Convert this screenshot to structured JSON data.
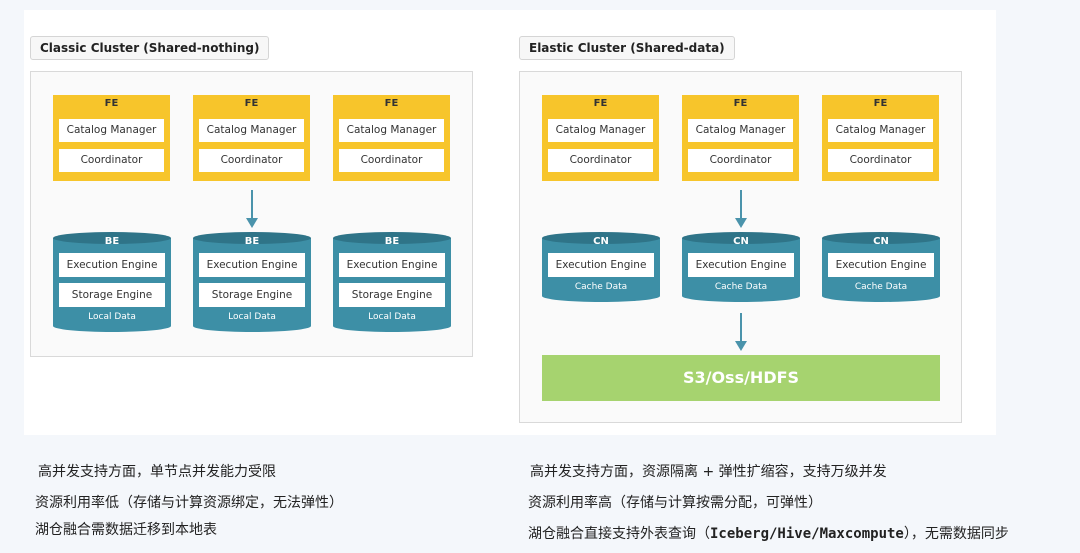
{
  "classic": {
    "title": "Classic Cluster (Shared-nothing)",
    "fe_nodes": [
      {
        "label": "FE",
        "catalog": "Catalog Manager",
        "coordinator": "Coordinator"
      },
      {
        "label": "FE",
        "catalog": "Catalog Manager",
        "coordinator": "Coordinator"
      },
      {
        "label": "FE",
        "catalog": "Catalog Manager",
        "coordinator": "Coordinator"
      }
    ],
    "be_nodes": [
      {
        "label": "BE",
        "execution": "Execution Engine",
        "storage": "Storage Engine",
        "data": "Local Data"
      },
      {
        "label": "BE",
        "execution": "Execution Engine",
        "storage": "Storage Engine",
        "data": "Local Data"
      },
      {
        "label": "BE",
        "execution": "Execution Engine",
        "storage": "Storage Engine",
        "data": "Local Data"
      }
    ]
  },
  "elastic": {
    "title": "Elastic Cluster (Shared-data)",
    "fe_nodes": [
      {
        "label": "FE",
        "catalog": "Catalog Manager",
        "coordinator": "Coordinator"
      },
      {
        "label": "FE",
        "catalog": "Catalog Manager",
        "coordinator": "Coordinator"
      },
      {
        "label": "FE",
        "catalog": "Catalog Manager",
        "coordinator": "Coordinator"
      }
    ],
    "cn_nodes": [
      {
        "label": "CN",
        "execution": "Execution Engine",
        "data": "Cache Data"
      },
      {
        "label": "CN",
        "execution": "Execution Engine",
        "data": "Cache Data"
      },
      {
        "label": "CN",
        "execution": "Execution Engine",
        "data": "Cache Data"
      }
    ],
    "storage": "S3/Oss/HDFS"
  },
  "notes_left": [
    "高并发支持方面，单节点并发能力受限",
    "资源利用率低（存储与计算资源绑定，无法弹性）",
    "湖仓融合需数据迁移到本地表"
  ],
  "notes_right": [
    "高并发支持方面，资源隔离 + 弹性扩缩容，支持万级并发",
    "资源利用率高（存储与计算按需分配，可弹性）"
  ],
  "notes_right_last": {
    "prefix": "湖仓融合直接支持外表查询（",
    "highlight": "Iceberg/Hive/Maxcompute",
    "suffix": "），无需数据同步"
  },
  "colors": {
    "fe": "#f7c52b",
    "node": "#3d8fa6",
    "node_dark": "#2f7488",
    "arrow": "#4a93ab",
    "storage": "#a6d36f"
  }
}
